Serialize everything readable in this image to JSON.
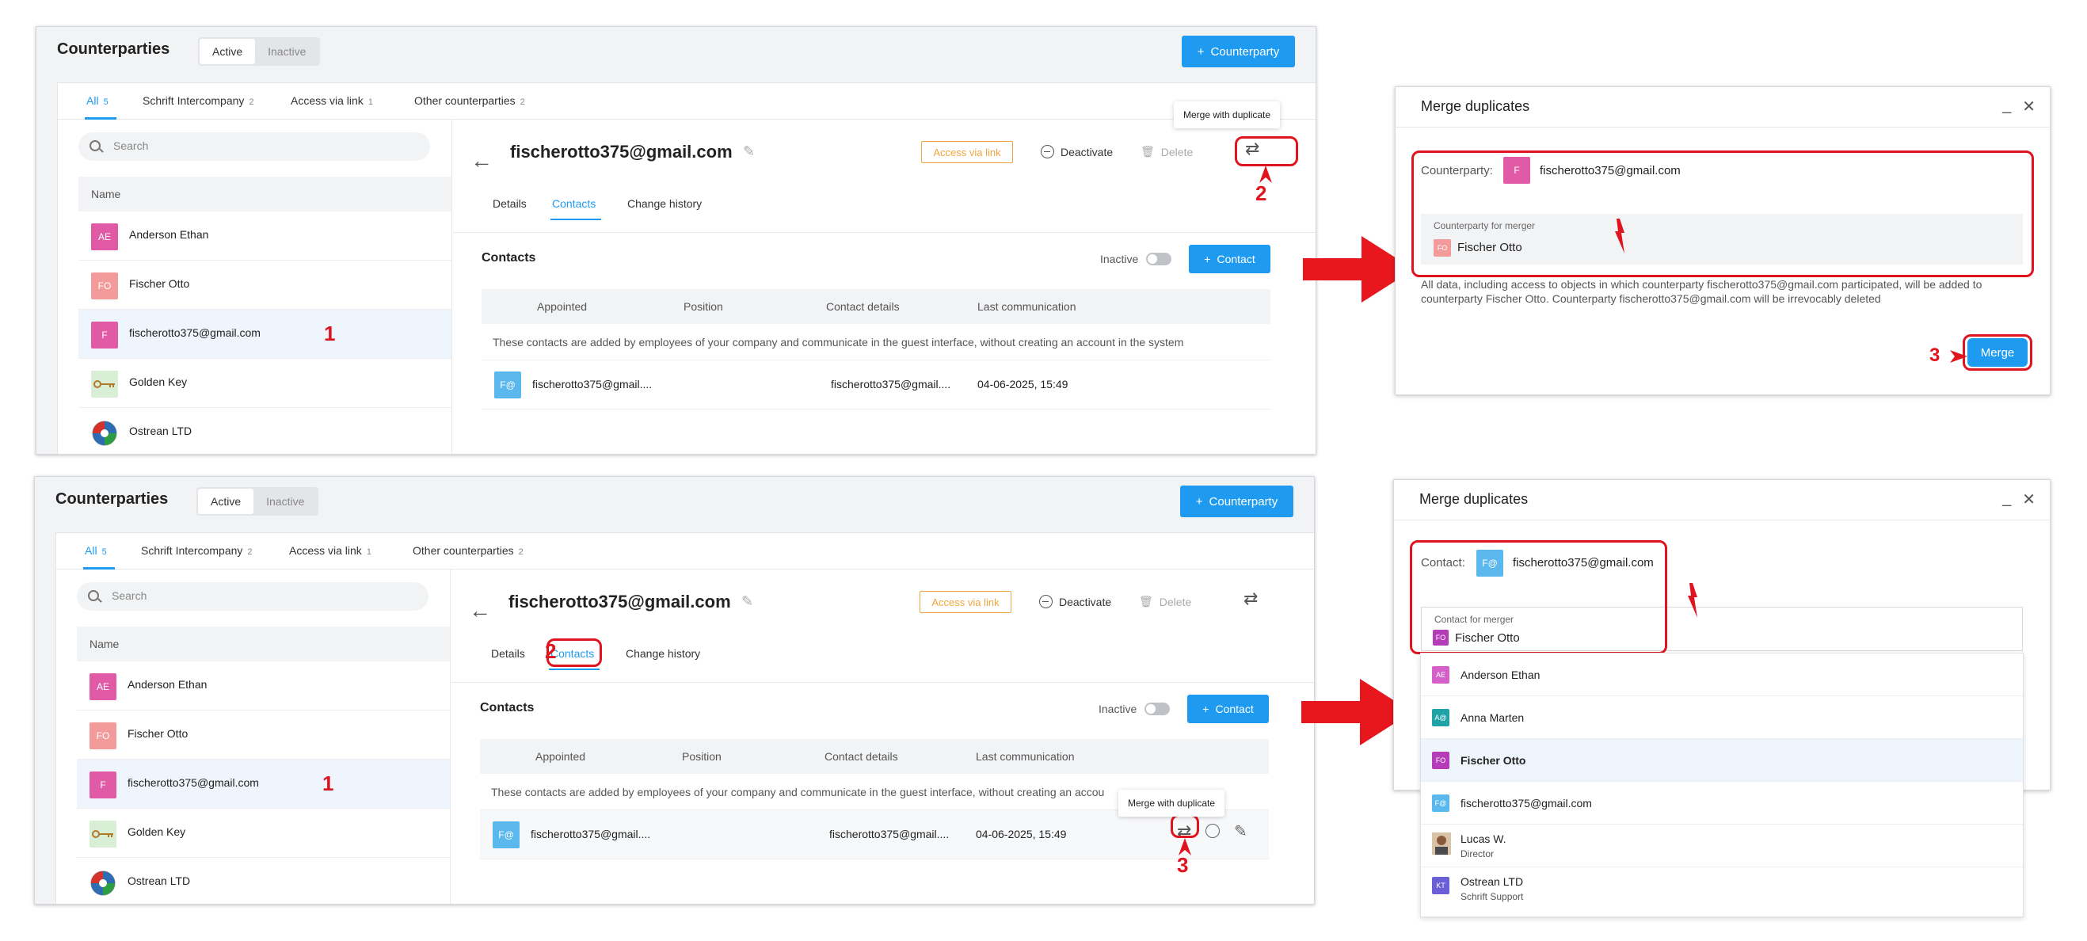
{
  "app": {
    "title": "Counterparties",
    "seg_active": "Active",
    "seg_inactive": "Inactive",
    "add_counterparty": "Counterparty",
    "filters": [
      {
        "label": "All",
        "count": "5"
      },
      {
        "label": "Schrift Intercompany",
        "count": "2"
      },
      {
        "label": "Access via link",
        "count": "1"
      },
      {
        "label": "Other counterparties",
        "count": "2"
      }
    ],
    "search_placeholder": "Search",
    "name_header": "Name",
    "list": [
      {
        "initials": "AE",
        "name": "Anderson Ethan",
        "color": "#e05aa6"
      },
      {
        "initials": "FO",
        "name": "Fischer Otto",
        "color": "#f39a9a"
      },
      {
        "initials": "F",
        "name": "fischerotto375@gmail.com",
        "color": "#e05aa6"
      },
      {
        "initials": "",
        "name": "Golden Key",
        "color": "#d9efd5"
      },
      {
        "initials": "",
        "name": "Ostrean LTD",
        "color": "#ffffff"
      }
    ],
    "detail_title": "fischerotto375@gmail.com",
    "access_badge": "Access via link",
    "deactivate": "Deactivate",
    "delete": "Delete",
    "tabs": [
      "Details",
      "Contacts",
      "Change history"
    ],
    "contacts_heading": "Contacts",
    "inactive_toggle": "Inactive",
    "add_contact": "Contact",
    "table_headers": [
      "Appointed",
      "Position",
      "Contact details",
      "Last communication"
    ],
    "table_note": "These contacts are added by employees of your company and communicate in the guest interface, without creating an account in the system",
    "table_note_cut": "These contacts are added by employees of your company and communicate in the guest interface, without creating an accou",
    "contact_row": {
      "initials": "F@",
      "name": "fischerotto375@gmail....",
      "details": "fischerotto375@gmail....",
      "last": "04-06-2025, 15:49"
    },
    "tooltip": "Merge with duplicate"
  },
  "dialog1": {
    "title": "Merge duplicates",
    "label": "Counterparty:",
    "avatar": "F",
    "value": "fischerotto375@gmail.com",
    "merger_caption": "Counterparty for merger",
    "merger_initials": "FO",
    "merger_value": "Fischer Otto",
    "note": "All data, including access to objects in which counterparty fischerotto375@gmail.com participated, will be added to counterparty Fischer Otto. Counterparty fischerotto375@gmail.com will be irrevocably deleted",
    "merge_button": "Merge"
  },
  "dialog2": {
    "title": "Merge duplicates",
    "label": "Contact:",
    "avatar": "F@",
    "value": "fischerotto375@gmail.com",
    "merger_caption": "Contact for merger",
    "merger_initials": "FO",
    "merger_value": "Fischer Otto",
    "options": [
      {
        "initials": "AE",
        "name": "Anderson Ethan",
        "sub": "",
        "color": "#d45fc9"
      },
      {
        "initials": "A@",
        "name": "Anna Marten",
        "sub": "",
        "color": "#1fa3a6"
      },
      {
        "initials": "FO",
        "name": "Fischer Otto",
        "sub": "",
        "color": "#b53cb8"
      },
      {
        "initials": "F@",
        "name": "fischerotto375@gmail.com",
        "sub": "",
        "color": "#5bb8ee"
      },
      {
        "initials": "",
        "name": "Lucas W.",
        "sub": "Director",
        "color": "#c9a27e"
      },
      {
        "initials": "KT",
        "name": "Ostrean LTD",
        "sub": "Schrift Support",
        "color": "#6a5fd6"
      }
    ]
  },
  "steps": {
    "one": "1",
    "two": "2",
    "three": "3"
  },
  "colors": {
    "accent": "#1e9bf0",
    "annotation_red": "#e0141e",
    "badge_orange": "#f0a640"
  }
}
